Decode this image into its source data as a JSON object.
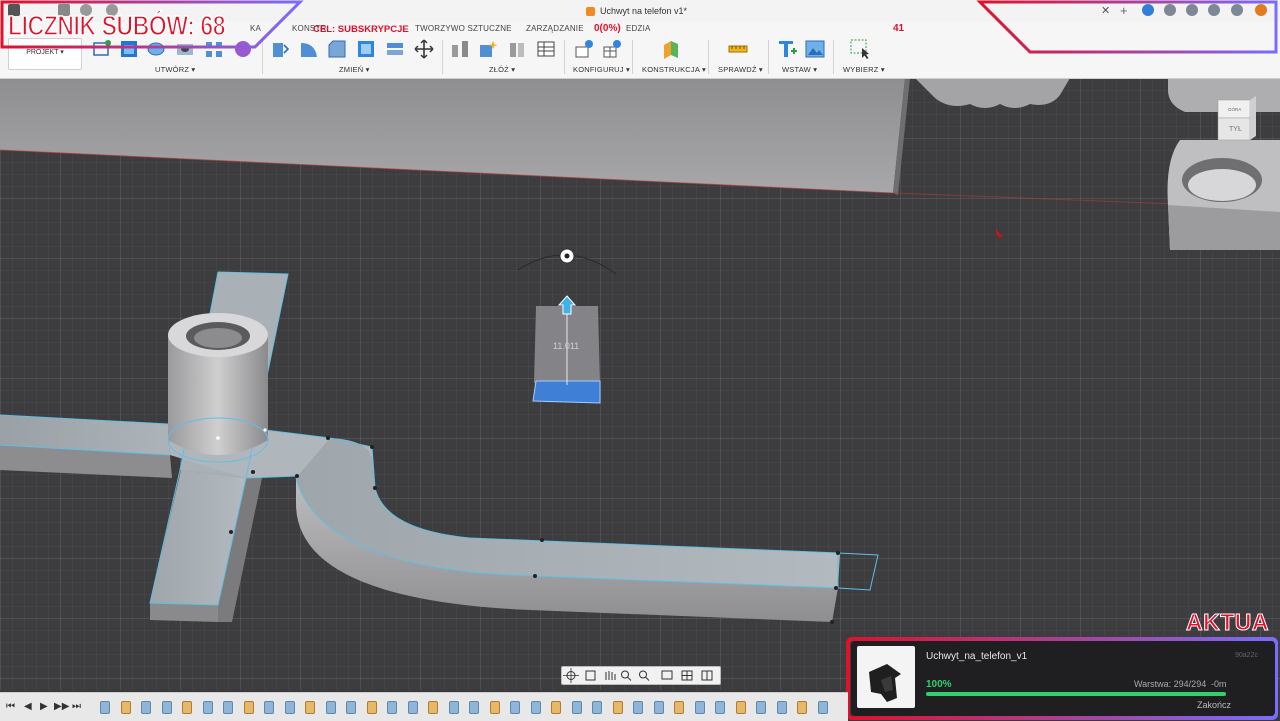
{
  "window": {
    "document_title": "Uchwyt na telefon v1*",
    "close_glyph": "✕",
    "new_tab_glyph": "+"
  },
  "toolbar": {
    "workspace": "PROJEKT",
    "tabs": [
      "KONSTR",
      "KA",
      "TWORZYWO SZTUCZNE",
      "ZARZĄDZANIE",
      "EDZIA"
    ],
    "groups": [
      "UTWÓRZ",
      "ZMIEŃ",
      "ZŁÓŻ",
      "KONFIGURUJ",
      "KONSTRUKCJA",
      "SPRAWDŹ",
      "WSTAW",
      "WYBIERZ"
    ],
    "dropdown_glyph": "▾"
  },
  "overlays": {
    "sub_counter": "LICZNIK SUBÓW: 68",
    "goal_label": "CEL: SUBSKRYPCJE",
    "goal_percent": "0(0%)",
    "goal_value": "41",
    "banner": "AKTUA"
  },
  "viewport": {
    "dimension_value": "11.011",
    "viewcube_top": "GÓRA",
    "viewcube_front": "TYŁ"
  },
  "print_panel": {
    "file_name": "Uchwyt_na_telefon_v1",
    "progress": 100,
    "progress_label": "100%",
    "layer": "Warstwa: 294/294",
    "remaining": "-0m",
    "finish_button": "Zakończ",
    "code": "90a22c"
  },
  "timeline": {
    "controls": [
      "⏮",
      "◀",
      "▶",
      "▶▶",
      "⏭"
    ],
    "step_count": 36
  },
  "colors": {
    "accent_red": "#e0112b",
    "selection": "#5fbfe6",
    "print_green": "#2fd16a",
    "overlay_gradient": [
      "#e0112b",
      "#7a6cff"
    ]
  }
}
